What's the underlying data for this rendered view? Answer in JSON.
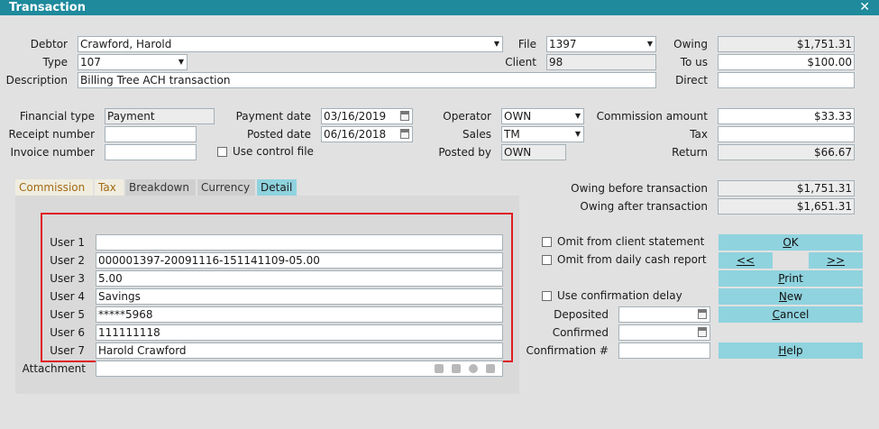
{
  "window": {
    "title": "Transaction",
    "close_glyph": "✕"
  },
  "header": {
    "debtor": {
      "label": "Debtor",
      "value": "Crawford, Harold"
    },
    "type": {
      "label": "Type",
      "value": "107"
    },
    "description": {
      "label": "Description",
      "value": "Billing Tree ACH transaction"
    },
    "file": {
      "label": "File",
      "value": "1397"
    },
    "client": {
      "label": "Client",
      "value": "98"
    },
    "owing": {
      "label": "Owing",
      "value": "$1,751.31"
    },
    "to_us": {
      "label": "To us",
      "value": "$100.00"
    },
    "direct": {
      "label": "Direct",
      "value": ""
    }
  },
  "middle": {
    "financial_type": {
      "label": "Financial type",
      "value": "Payment"
    },
    "receipt_number": {
      "label": "Receipt number",
      "value": ""
    },
    "invoice_number": {
      "label": "Invoice number",
      "value": ""
    },
    "payment_date": {
      "label": "Payment date",
      "value": "03/16/2019"
    },
    "posted_date": {
      "label": "Posted date",
      "value": "06/16/2018"
    },
    "use_control_file": {
      "label": "Use control file",
      "checked": false
    },
    "operator": {
      "label": "Operator",
      "value": "OWN"
    },
    "sales": {
      "label": "Sales",
      "value": "TM"
    },
    "posted_by": {
      "label": "Posted by",
      "value": "OWN"
    },
    "commission_amount": {
      "label": "Commission amount",
      "value": "$33.33"
    },
    "tax": {
      "label": "Tax",
      "value": ""
    },
    "return": {
      "label": "Return",
      "value": "$66.67"
    }
  },
  "tabs": [
    {
      "label": "Commission",
      "active": false
    },
    {
      "label": "Tax",
      "active": false
    },
    {
      "label": "Breakdown",
      "active": false
    },
    {
      "label": "Currency",
      "active": false
    },
    {
      "label": "Detail",
      "active": true
    }
  ],
  "detail": {
    "users": [
      {
        "label": "User 1",
        "value": ""
      },
      {
        "label": "User 2",
        "value": "000001397-20091116-151141109-05.00"
      },
      {
        "label": "User 3",
        "value": "5.00"
      },
      {
        "label": "User 4",
        "value": "Savings"
      },
      {
        "label": "User 5",
        "value": "*****5968"
      },
      {
        "label": "User 6",
        "value": "111111118"
      },
      {
        "label": "User 7",
        "value": "Harold Crawford"
      }
    ],
    "attachment": {
      "label": "Attachment",
      "value": ""
    }
  },
  "right": {
    "owing_before": {
      "label": "Owing before transaction",
      "value": "$1,751.31"
    },
    "owing_after": {
      "label": "Owing after transaction",
      "value": "$1,651.31"
    },
    "omit_client_statement": {
      "label": "Omit from client statement",
      "checked": false
    },
    "omit_daily_cash_report": {
      "label": "Omit from daily cash report",
      "checked": false
    },
    "use_confirmation_delay": {
      "label": "Use confirmation delay",
      "checked": false
    },
    "deposited": {
      "label": "Deposited",
      "value": ""
    },
    "confirmed": {
      "label": "Confirmed",
      "value": ""
    },
    "confirmation_number": {
      "label": "Confirmation #",
      "value": ""
    }
  },
  "buttons": {
    "ok": {
      "u": "O",
      "rest": "K"
    },
    "prev": "<<",
    "next": ">>",
    "print": {
      "u": "P",
      "rest": "rint"
    },
    "new": {
      "u": "N",
      "rest": "ew"
    },
    "cancel": {
      "u": "C",
      "rest": "ancel"
    },
    "help": {
      "u": "H",
      "rest": "elp"
    }
  },
  "colors": {
    "titlebar": "#1e8a9c",
    "button": "#8fd3de",
    "active_tab": "#8fd3de",
    "highlight_box": "#e01b24",
    "dialog_bg": "#e1e1e1"
  },
  "icons": {
    "dropdown": "▼",
    "calendar": "calendar-icon"
  }
}
